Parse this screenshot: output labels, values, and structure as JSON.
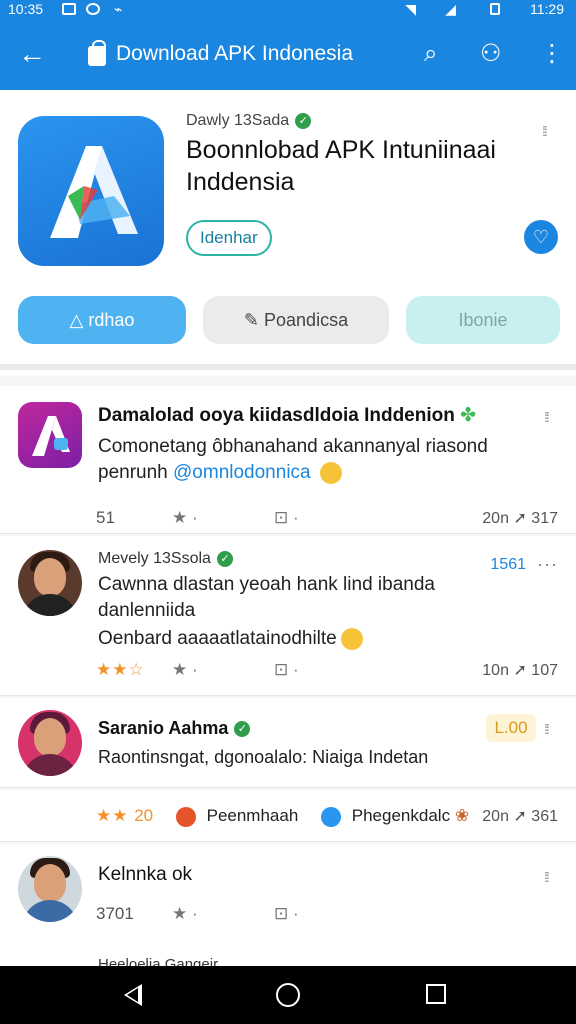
{
  "status_bar": {
    "time_left": "10:35",
    "time_right": "11:29"
  },
  "app_bar": {
    "title": "Download APK Indonesia",
    "icons": [
      "back-arrow-icon",
      "shopping-bag-icon",
      "search-icon",
      "profile-icon",
      "more-vert-icon"
    ]
  },
  "app": {
    "developer": "Dawly 13Sada",
    "title": "Boonnlobad APK Intuniinaai Inddensia",
    "tag": "Idenhar",
    "buttons": {
      "install": "rdhao",
      "secondary": "Poandicsa",
      "tertiary": "Ibonie"
    }
  },
  "posts": [
    {
      "name": "Damalolad ooya kiidasdldoia Inddenion",
      "text": "Comonetang ôbhanahand akannanyal riasond",
      "text2_prefix": "penrunh",
      "mention": "@omnlodonnica",
      "action_left": "51",
      "stat": "20n",
      "stat2": "317"
    },
    {
      "header": "Mevely 13Ssola",
      "badge": "1561",
      "text": "Cawnna dlastan yeoah hank lind ibanda danlenniida",
      "text2": "Oenbard aaaaatlatainodhilte",
      "stat": "10n",
      "stat2": "107"
    },
    {
      "name": "Saranio Aahma",
      "badge": "L.00",
      "text": "Raontinsngat, dgonoalalo: Niaiga Indetan"
    },
    {
      "stars_label": "20",
      "category1": "Peenmhaah",
      "category2": "Phegenkdalc",
      "stat": "20n",
      "stat2": "361"
    },
    {
      "name": "Kelnnka ok",
      "action_left": "3701",
      "next_header": "Heeloelia Gangeir"
    }
  ],
  "colors": {
    "primary": "#1b86e0",
    "install": "#4fb2f1",
    "verified": "#2e9e4a",
    "star": "#f2922a"
  }
}
